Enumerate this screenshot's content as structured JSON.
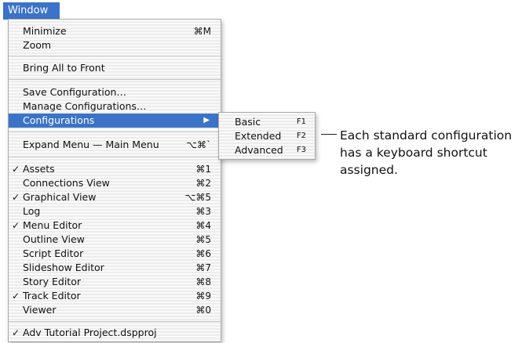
{
  "menubar": {
    "title": "Window"
  },
  "menu": {
    "minimize": {
      "label": "Minimize",
      "shortcut": "⌘M"
    },
    "zoom": {
      "label": "Zoom"
    },
    "bring_all": {
      "label": "Bring All to Front"
    },
    "save_config": {
      "label": "Save Configuration…"
    },
    "manage_config": {
      "label": "Manage Configurations…"
    },
    "configurations": {
      "label": "Configurations",
      "arrow": "▶"
    },
    "expand_menu": {
      "label": "Expand Menu — Main Menu",
      "shortcut": "⌥⌘`"
    },
    "views": [
      {
        "label": "Assets",
        "shortcut": "⌘1",
        "check": "✓"
      },
      {
        "label": "Connections View",
        "shortcut": "⌘2",
        "check": ""
      },
      {
        "label": "Graphical View",
        "shortcut": "⌥⌘5",
        "check": "✓"
      },
      {
        "label": "Log",
        "shortcut": "⌘3",
        "check": ""
      },
      {
        "label": "Menu Editor",
        "shortcut": "⌘4",
        "check": "✓"
      },
      {
        "label": "Outline View",
        "shortcut": "⌘5",
        "check": ""
      },
      {
        "label": "Script Editor",
        "shortcut": "⌘6",
        "check": ""
      },
      {
        "label": "Slideshow Editor",
        "shortcut": "⌘7",
        "check": ""
      },
      {
        "label": "Story Editor",
        "shortcut": "⌘8",
        "check": ""
      },
      {
        "label": "Track Editor",
        "shortcut": "⌘9",
        "check": "✓"
      },
      {
        "label": "Viewer",
        "shortcut": "⌘0",
        "check": ""
      }
    ],
    "project": {
      "label": "Adv Tutorial Project.dspproj",
      "check": "✓"
    }
  },
  "submenu": {
    "items": [
      {
        "label": "Basic",
        "shortcut": "F1"
      },
      {
        "label": "Extended",
        "shortcut": "F2"
      },
      {
        "label": "Advanced",
        "shortcut": "F3"
      }
    ]
  },
  "callout": {
    "lines": [
      "Each standard configuration",
      "has a keyboard shortcut",
      "assigned."
    ]
  }
}
